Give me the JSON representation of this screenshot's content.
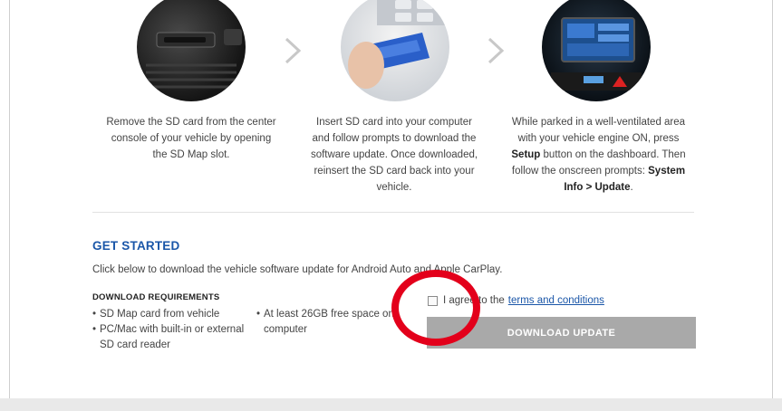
{
  "steps": [
    {
      "image_icon": "sd-card-slot-image",
      "text": "Remove the SD card from the center console of your vehicle by opening the SD Map slot."
    },
    {
      "image_icon": "sd-card-laptop-image",
      "text": "Insert SD card into your computer and follow prompts to download the software update. Once downloaded, reinsert the SD card back into your vehicle."
    },
    {
      "image_icon": "infotainment-screen-image",
      "text_before": "While parked in a well-ventilated area with your vehicle engine ON, press ",
      "setup_label": "Setup",
      "text_middle": " button on the dashboard. Then follow the onscreen prompts: ",
      "path_label": "System Info > Update",
      "text_end": "."
    }
  ],
  "get_started": {
    "title": "GET STARTED",
    "description": "Click below to download the vehicle software update for Android Auto and Apple CarPlay."
  },
  "requirements": {
    "title": "DOWNLOAD REQUIREMENTS",
    "col1": [
      "SD Map card from vehicle",
      "PC/Mac with built-in or external SD card reader"
    ],
    "col2": [
      "At least 26GB free space on computer"
    ]
  },
  "agreement": {
    "prefix": "I agree to the",
    "link_text": "terms and conditions",
    "checked": false
  },
  "download_button": {
    "label": "DOWNLOAD UPDATE"
  },
  "annotation": {
    "color": "#e3001b"
  },
  "colors": {
    "accent": "#1a56a8",
    "button_disabled": "#a9a9a9"
  }
}
